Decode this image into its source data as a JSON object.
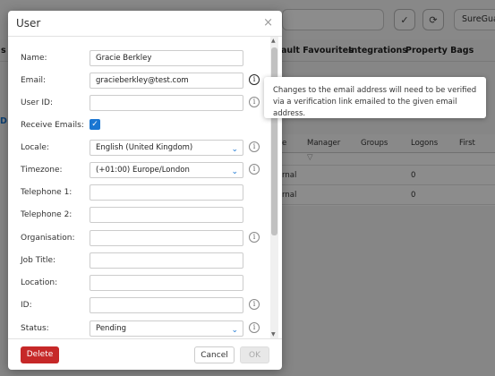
{
  "background": {
    "header_button": "SureGua",
    "tabs": [
      "ault Favourites",
      "Integrations",
      "Property Bags"
    ],
    "left_fragments": [
      "s",
      "D"
    ],
    "grid": {
      "columns": [
        "e",
        "Manager",
        "Groups",
        "Logons",
        "First"
      ],
      "rows": [
        {
          "col0": "rnal",
          "logons": "0"
        },
        {
          "col0": "rnal",
          "logons": "0"
        }
      ]
    }
  },
  "dialog": {
    "title": "User",
    "close": "×",
    "fields": {
      "name": {
        "label": "Name:",
        "value": "Gracie Berkley"
      },
      "email": {
        "label": "Email:",
        "value": "gracieberkley@test.com"
      },
      "user_id": {
        "label": "User ID:",
        "value": ""
      },
      "receive_emails": {
        "label": "Receive Emails:",
        "checked": true
      },
      "locale": {
        "label": "Locale:",
        "value": "English (United Kingdom)"
      },
      "timezone": {
        "label": "Timezone:",
        "value": "(+01:00) Europe/London"
      },
      "telephone1": {
        "label": "Telephone 1:",
        "value": ""
      },
      "telephone2": {
        "label": "Telephone 2:",
        "value": ""
      },
      "organisation": {
        "label": "Organisation:",
        "value": ""
      },
      "job_title": {
        "label": "Job Title:",
        "value": ""
      },
      "location": {
        "label": "Location:",
        "value": ""
      },
      "id": {
        "label": "ID:",
        "value": ""
      },
      "status": {
        "label": "Status:",
        "value": "Pending"
      }
    },
    "buttons": {
      "delete": "Delete",
      "cancel": "Cancel",
      "ok": "OK"
    }
  },
  "tooltip": {
    "text": "Changes to the email address will need to be verified via a verification link emailed to the given email address."
  },
  "icons": {
    "info": "i",
    "check": "✓",
    "chevron": "⌄",
    "refresh": "⟳",
    "check_circle": "✓"
  }
}
